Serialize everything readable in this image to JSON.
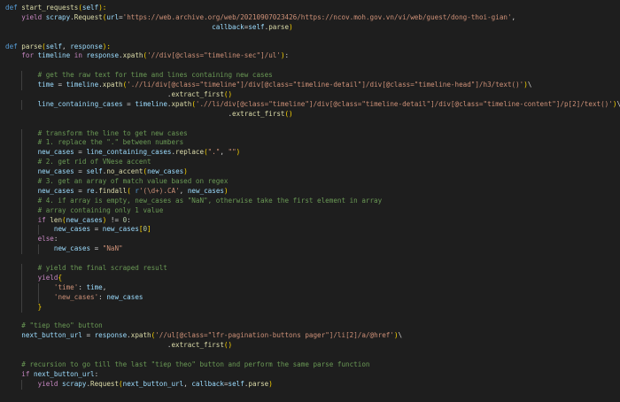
{
  "editor": {
    "language": "python",
    "theme_colors": {
      "background": "#1e1e1e",
      "keyword": "#569cd6",
      "control": "#c586c0",
      "function": "#dcdcaa",
      "variable": "#9cdcfe",
      "string": "#ce9178",
      "comment": "#6a9955",
      "number": "#b5cea8",
      "bracket_1": "#ffd700",
      "bracket_2": "#da70d6",
      "bracket_3": "#179fff"
    },
    "lines": [
      {
        "indent": 0,
        "tokens": [
          [
            "kw",
            "def "
          ],
          [
            "fn",
            "start_requests"
          ],
          [
            "br1",
            "("
          ],
          [
            "var",
            "self"
          ],
          [
            "br1",
            "):"
          ]
        ]
      },
      {
        "indent": 1,
        "tokens": [
          [
            "ctl",
            "yield "
          ],
          [
            "var",
            "scrapy"
          ],
          [
            "pn",
            "."
          ],
          [
            "fn",
            "Request"
          ],
          [
            "br1",
            "("
          ],
          [
            "var",
            "url"
          ],
          [
            "op",
            "="
          ],
          [
            "str",
            "'https://web.archive.org/web/20210907023426/https://ncov.moh.gov.vn/vi/web/guest/dong-thoi-gian'"
          ],
          [
            "pn",
            ","
          ]
        ]
      },
      {
        "indent": 0,
        "tokens": [
          [
            "pn",
            "                                                   "
          ],
          [
            "var",
            "callback"
          ],
          [
            "op",
            "="
          ],
          [
            "var",
            "self"
          ],
          [
            "pn",
            "."
          ],
          [
            "fn",
            "parse"
          ],
          [
            "br1",
            ")"
          ]
        ]
      },
      {
        "indent": 0,
        "tokens": []
      },
      {
        "indent": 0,
        "tokens": [
          [
            "kw",
            "def "
          ],
          [
            "fn",
            "parse"
          ],
          [
            "br1",
            "("
          ],
          [
            "var",
            "self"
          ],
          [
            "pn",
            ", "
          ],
          [
            "var",
            "response"
          ],
          [
            "br1",
            "):"
          ]
        ]
      },
      {
        "indent": 1,
        "tokens": [
          [
            "ctl",
            "for "
          ],
          [
            "var",
            "timeline"
          ],
          [
            "ctl",
            " in "
          ],
          [
            "var",
            "response"
          ],
          [
            "pn",
            "."
          ],
          [
            "fn",
            "xpath"
          ],
          [
            "br1",
            "("
          ],
          [
            "str",
            "'//div[@class=\"timeline-sec\"]/ul'"
          ],
          [
            "br1",
            ")"
          ],
          [
            "pn",
            ":"
          ]
        ]
      },
      {
        "indent": 0,
        "tokens": []
      },
      {
        "indent": 2,
        "tokens": [
          [
            "com",
            "# get the raw text for time and lines containing new cases"
          ]
        ]
      },
      {
        "indent": 2,
        "tokens": [
          [
            "var",
            "time"
          ],
          [
            "op",
            " = "
          ],
          [
            "var",
            "timeline"
          ],
          [
            "pn",
            "."
          ],
          [
            "fn",
            "xpath"
          ],
          [
            "br1",
            "("
          ],
          [
            "str",
            "'.//li/div[@class=\"timeline\"]/div[@class=\"timeline-detail\"]/div[@class=\"timeline-head\"]/h3/text()'"
          ],
          [
            "br1",
            ")"
          ],
          [
            "pn",
            "\\"
          ]
        ]
      },
      {
        "indent": 0,
        "tokens": [
          [
            "pn",
            "                                        ."
          ],
          [
            "fn",
            "extract_first"
          ],
          [
            "br1",
            "()"
          ]
        ]
      },
      {
        "indent": 2,
        "tokens": [
          [
            "var",
            "line_containing_cases"
          ],
          [
            "op",
            " = "
          ],
          [
            "var",
            "timeline"
          ],
          [
            "pn",
            "."
          ],
          [
            "fn",
            "xpath"
          ],
          [
            "br1",
            "("
          ],
          [
            "str",
            "'.//li/div[@class=\"timeline\"]/div[@class=\"timeline-detail\"]/div[@class=\"timeline-content\"]/p[2]/text()'"
          ],
          [
            "br1",
            ")"
          ],
          [
            "pn",
            "\\"
          ]
        ]
      },
      {
        "indent": 0,
        "tokens": [
          [
            "pn",
            "                                                       ."
          ],
          [
            "fn",
            "extract_first"
          ],
          [
            "br1",
            "()"
          ]
        ]
      },
      {
        "indent": 0,
        "tokens": []
      },
      {
        "indent": 2,
        "tokens": [
          [
            "com",
            "# transform the line to get new cases"
          ]
        ]
      },
      {
        "indent": 2,
        "tokens": [
          [
            "com",
            "# 1. replace the \".\" between numbers"
          ]
        ]
      },
      {
        "indent": 2,
        "tokens": [
          [
            "var",
            "new_cases"
          ],
          [
            "op",
            " = "
          ],
          [
            "var",
            "line_containing_cases"
          ],
          [
            "pn",
            "."
          ],
          [
            "fn",
            "replace"
          ],
          [
            "br1",
            "("
          ],
          [
            "str",
            "\".\""
          ],
          [
            "pn",
            ", "
          ],
          [
            "str",
            "\"\""
          ],
          [
            "br1",
            ")"
          ]
        ]
      },
      {
        "indent": 2,
        "tokens": [
          [
            "com",
            "# 2. get rid of VNese accent"
          ]
        ]
      },
      {
        "indent": 2,
        "tokens": [
          [
            "var",
            "new_cases"
          ],
          [
            "op",
            " = "
          ],
          [
            "var",
            "self"
          ],
          [
            "pn",
            "."
          ],
          [
            "fn",
            "no_accent"
          ],
          [
            "br1",
            "("
          ],
          [
            "var",
            "new_cases"
          ],
          [
            "br1",
            ")"
          ]
        ]
      },
      {
        "indent": 2,
        "tokens": [
          [
            "com",
            "# 3. get an array of match value based on regex"
          ]
        ]
      },
      {
        "indent": 2,
        "tokens": [
          [
            "var",
            "new_cases"
          ],
          [
            "op",
            " = "
          ],
          [
            "var",
            "re"
          ],
          [
            "pn",
            "."
          ],
          [
            "fn",
            "findall"
          ],
          [
            "br1",
            "("
          ],
          [
            "pn",
            " "
          ],
          [
            "kw",
            "r"
          ],
          [
            "str",
            "'(\\d+).CA'"
          ],
          [
            "pn",
            ", "
          ],
          [
            "var",
            "new_cases"
          ],
          [
            "br1",
            ")"
          ]
        ]
      },
      {
        "indent": 2,
        "tokens": [
          [
            "com",
            "# 4. if array is empty, new_cases as \"NaN\", otherwise take the first element in array"
          ]
        ]
      },
      {
        "indent": 2,
        "tokens": [
          [
            "com",
            "# array containing only 1 value"
          ]
        ]
      },
      {
        "indent": 2,
        "tokens": [
          [
            "ctl",
            "if "
          ],
          [
            "fn",
            "len"
          ],
          [
            "br1",
            "("
          ],
          [
            "var",
            "new_cases"
          ],
          [
            "br1",
            ")"
          ],
          [
            "op",
            " != "
          ],
          [
            "num",
            "0"
          ],
          [
            "pn",
            ":"
          ]
        ]
      },
      {
        "indent": 3,
        "tokens": [
          [
            "var",
            "new_cases"
          ],
          [
            "op",
            " = "
          ],
          [
            "var",
            "new_cases"
          ],
          [
            "br1",
            "["
          ],
          [
            "num",
            "0"
          ],
          [
            "br1",
            "]"
          ]
        ]
      },
      {
        "indent": 2,
        "tokens": [
          [
            "ctl",
            "else"
          ],
          [
            "pn",
            ":"
          ]
        ]
      },
      {
        "indent": 3,
        "tokens": [
          [
            "var",
            "new_cases"
          ],
          [
            "op",
            " = "
          ],
          [
            "str",
            "\"NaN\""
          ]
        ]
      },
      {
        "indent": 0,
        "tokens": []
      },
      {
        "indent": 2,
        "tokens": [
          [
            "com",
            "# yield the final scraped result"
          ]
        ]
      },
      {
        "indent": 2,
        "tokens": [
          [
            "ctl",
            "yield"
          ],
          [
            "br1",
            "{"
          ]
        ]
      },
      {
        "indent": 3,
        "tokens": [
          [
            "str",
            "'time'"
          ],
          [
            "pn",
            ": "
          ],
          [
            "var",
            "time"
          ],
          [
            "pn",
            ","
          ]
        ]
      },
      {
        "indent": 3,
        "tokens": [
          [
            "str",
            "'new_cases'"
          ],
          [
            "pn",
            ": "
          ],
          [
            "var",
            "new_cases"
          ]
        ]
      },
      {
        "indent": 2,
        "tokens": [
          [
            "br1",
            "}"
          ]
        ]
      },
      {
        "indent": 0,
        "tokens": []
      },
      {
        "indent": 1,
        "tokens": [
          [
            "com",
            "# \"tiep theo\" button"
          ]
        ]
      },
      {
        "indent": 1,
        "tokens": [
          [
            "var",
            "next_button_url"
          ],
          [
            "op",
            " = "
          ],
          [
            "var",
            "response"
          ],
          [
            "pn",
            "."
          ],
          [
            "fn",
            "xpath"
          ],
          [
            "br1",
            "("
          ],
          [
            "str",
            "'//ul[@class=\"lfr-pagination-buttons pager\"]/li[2]/a/@href'"
          ],
          [
            "br1",
            ")"
          ],
          [
            "pn",
            "\\"
          ]
        ]
      },
      {
        "indent": 0,
        "tokens": [
          [
            "pn",
            "                                        ."
          ],
          [
            "fn",
            "extract_first"
          ],
          [
            "br1",
            "()"
          ]
        ]
      },
      {
        "indent": 0,
        "tokens": []
      },
      {
        "indent": 1,
        "tokens": [
          [
            "com",
            "# recursion to go till the last \"tiep theo\" button and perform the same parse function"
          ]
        ]
      },
      {
        "indent": 1,
        "tokens": [
          [
            "ctl",
            "if "
          ],
          [
            "var",
            "next_button_url"
          ],
          [
            "pn",
            ":"
          ]
        ]
      },
      {
        "indent": 2,
        "tokens": [
          [
            "ctl",
            "yield "
          ],
          [
            "var",
            "scrapy"
          ],
          [
            "pn",
            "."
          ],
          [
            "fn",
            "Request"
          ],
          [
            "br1",
            "("
          ],
          [
            "var",
            "next_button_url"
          ],
          [
            "pn",
            ", "
          ],
          [
            "var",
            "callback"
          ],
          [
            "op",
            "="
          ],
          [
            "var",
            "self"
          ],
          [
            "pn",
            "."
          ],
          [
            "fn",
            "parse"
          ],
          [
            "br1",
            ")"
          ]
        ]
      }
    ]
  }
}
